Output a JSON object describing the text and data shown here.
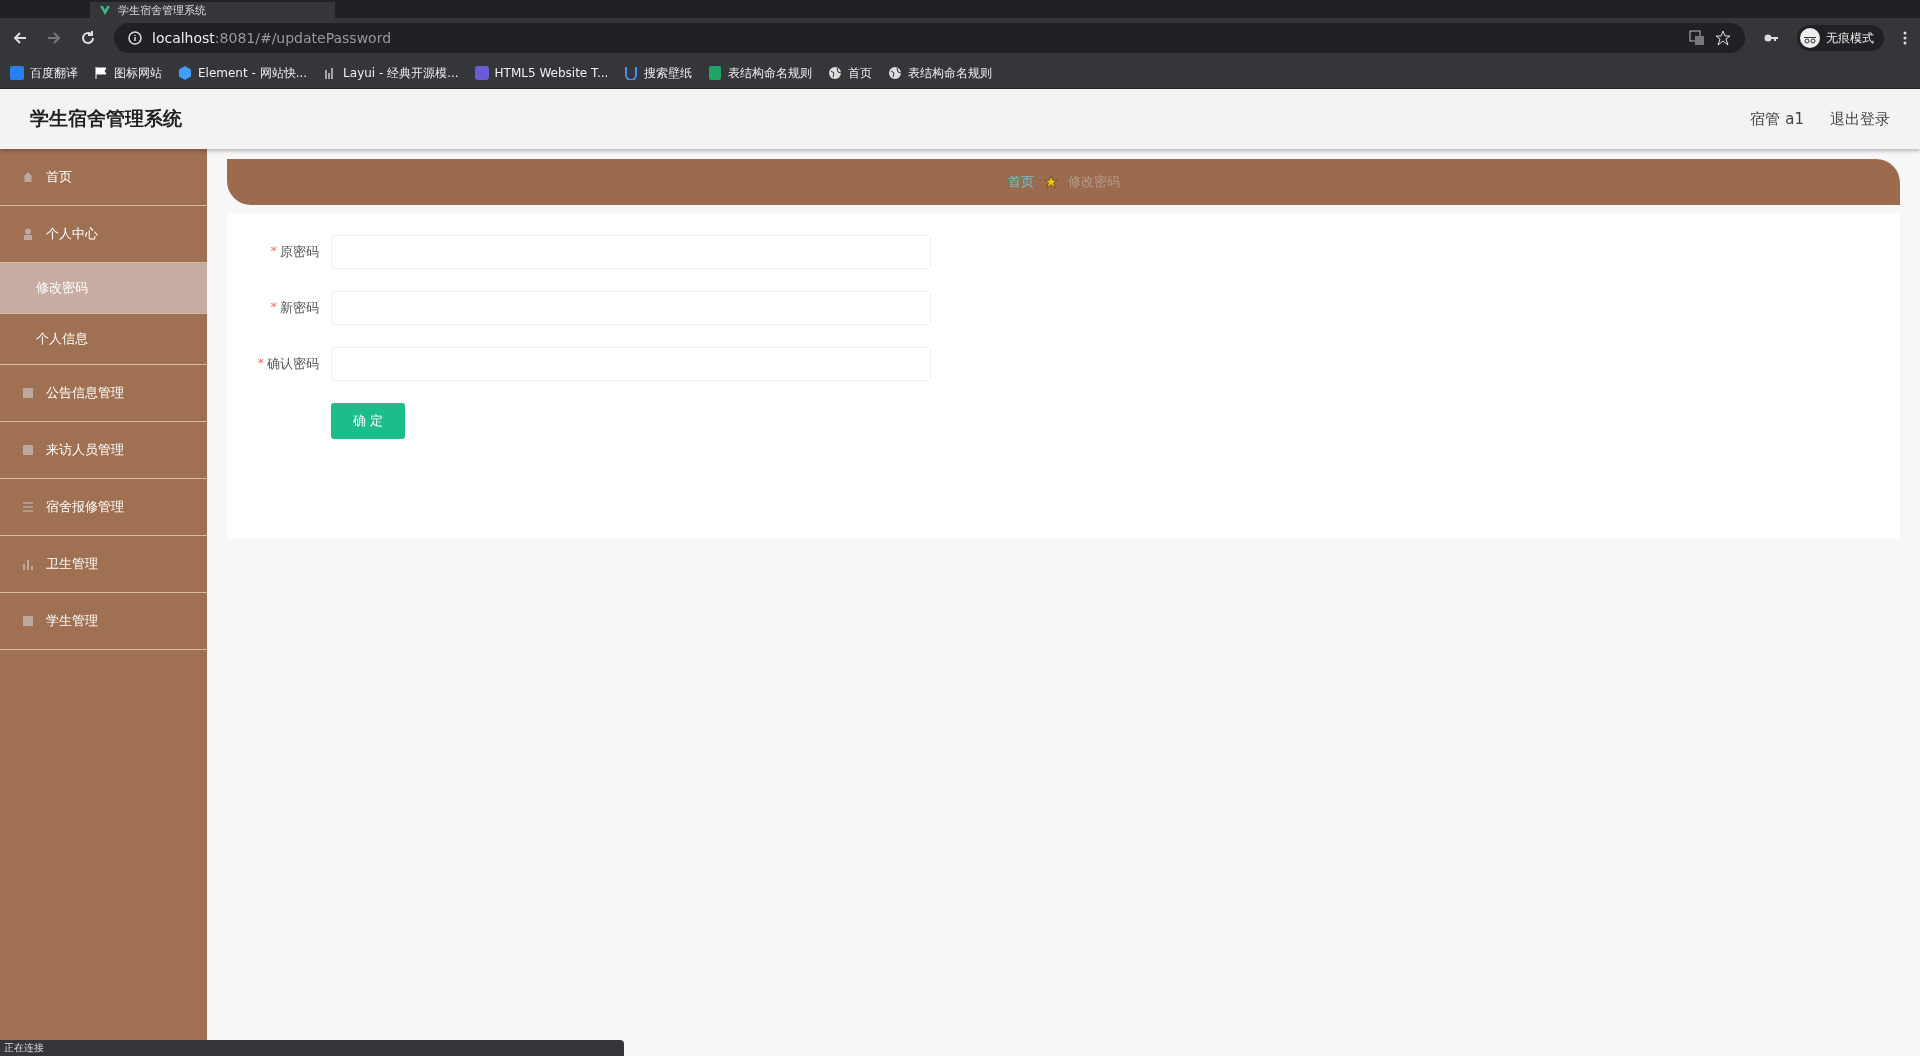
{
  "browser": {
    "tab_title": "学生宿舍管理系统",
    "address": {
      "host": "localhost",
      "rest": ":8081/#/updatePassword"
    },
    "profile_label": "无痕模式",
    "bookmarks": [
      {
        "kind": "translate",
        "label": "百度翻译"
      },
      {
        "kind": "flag",
        "label": "图标网站"
      },
      {
        "kind": "hex",
        "label": "Element - 网站快..."
      },
      {
        "kind": "bars",
        "label": "Layui - 经典开源模..."
      },
      {
        "kind": "square",
        "label": "HTML5 Website T..."
      },
      {
        "kind": "cup",
        "label": "搜索壁纸"
      },
      {
        "kind": "sheet",
        "label": "表结构命名规则"
      },
      {
        "kind": "globe",
        "label": "首页"
      },
      {
        "kind": "globe",
        "label": "表结构命名规则"
      }
    ]
  },
  "header": {
    "title": "学生宿舍管理系统",
    "user": "宿管 a1",
    "logout": "退出登录"
  },
  "sidebar": {
    "items": [
      {
        "label": "首页",
        "kind": "home",
        "selected": false
      },
      {
        "label": "个人中心",
        "kind": "user",
        "selected": false,
        "children": [
          {
            "label": "修改密码",
            "selected": true
          },
          {
            "label": "个人信息",
            "selected": false
          }
        ]
      },
      {
        "label": "公告信息管理",
        "kind": "box",
        "selected": false
      },
      {
        "label": "来访人员管理",
        "kind": "box",
        "selected": false
      },
      {
        "label": "宿舍报修管理",
        "kind": "list",
        "selected": false
      },
      {
        "label": "卫生管理",
        "kind": "chart",
        "selected": false
      },
      {
        "label": "学生管理",
        "kind": "box",
        "selected": false
      }
    ]
  },
  "breadcrumb": [
    "首页",
    "修改密码"
  ],
  "form": {
    "fields": [
      {
        "label": "原密码",
        "required_mark": "*"
      },
      {
        "label": "新密码",
        "required_mark": "*"
      },
      {
        "label": "确认密码",
        "required_mark": "*"
      }
    ],
    "submit": "确 定"
  },
  "status_bar": "正在连接"
}
